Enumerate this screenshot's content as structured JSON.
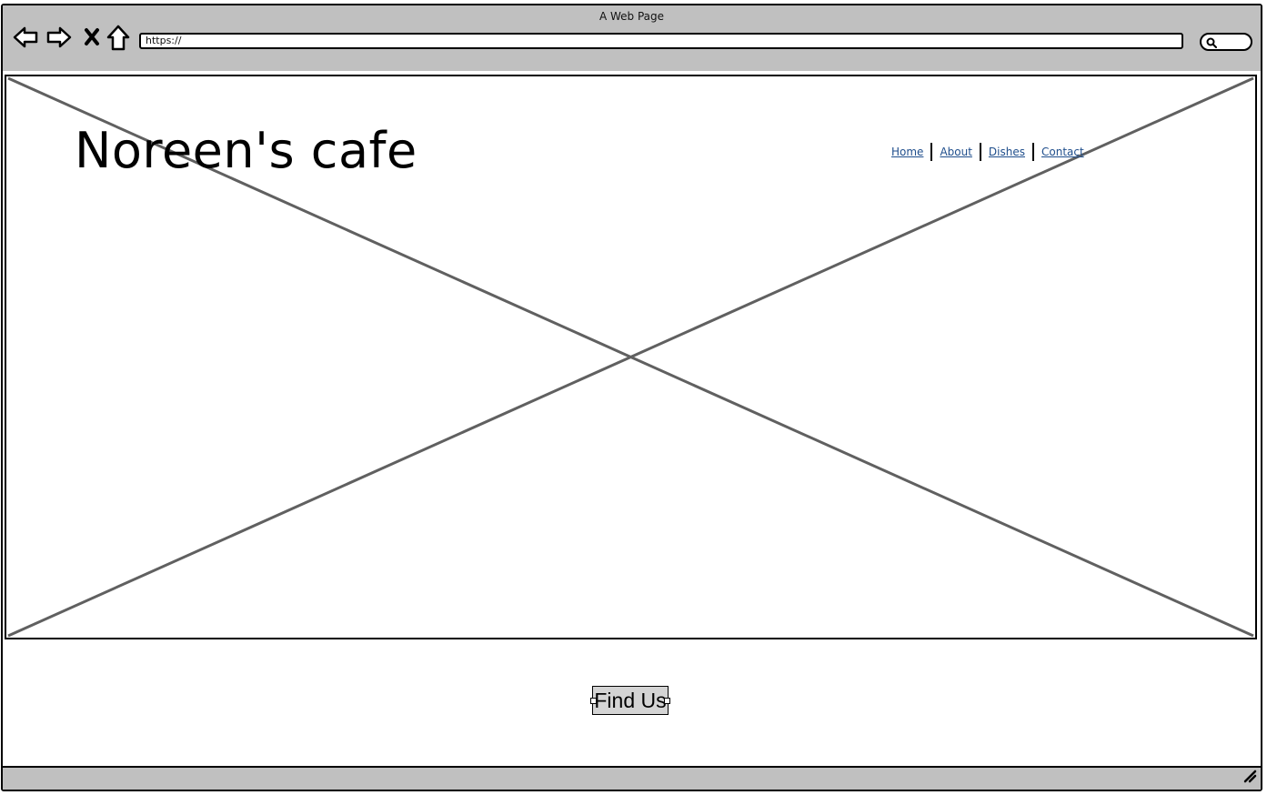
{
  "window": {
    "title": "A Web Page"
  },
  "toolbar": {
    "back_icon": "back-arrow-icon",
    "forward_icon": "forward-arrow-icon",
    "stop_icon": "close-icon",
    "home_icon": "home-icon",
    "url_value": "https://",
    "search_icon": "search-icon"
  },
  "header": {
    "site_title": "Noreen's cafe",
    "nav": [
      {
        "label": "Home"
      },
      {
        "label": "About"
      },
      {
        "label": "Dishes"
      },
      {
        "label": "Contact"
      }
    ],
    "link_color": "#1f4e8c"
  },
  "hero": {
    "type": "image-placeholder"
  },
  "main": {
    "find_us_label": "Find Us"
  },
  "colors": {
    "chrome": "#c0c0c0",
    "placeholder_line": "#606060",
    "button_fill": "#d4d4d4"
  }
}
